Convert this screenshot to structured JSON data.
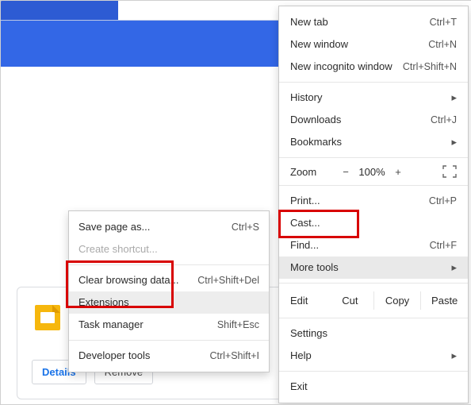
{
  "main_menu": {
    "new_tab": {
      "label": "New tab",
      "shortcut": "Ctrl+T"
    },
    "new_window": {
      "label": "New window",
      "shortcut": "Ctrl+N"
    },
    "new_incognito": {
      "label": "New incognito window",
      "shortcut": "Ctrl+Shift+N"
    },
    "history": {
      "label": "History"
    },
    "downloads": {
      "label": "Downloads",
      "shortcut": "Ctrl+J"
    },
    "bookmarks": {
      "label": "Bookmarks"
    },
    "zoom": {
      "label": "Zoom",
      "minus": "−",
      "pct": "100%",
      "plus": "+"
    },
    "print": {
      "label": "Print...",
      "shortcut": "Ctrl+P"
    },
    "cast": {
      "label": "Cast..."
    },
    "find": {
      "label": "Find...",
      "shortcut": "Ctrl+F"
    },
    "more_tools": {
      "label": "More tools"
    },
    "edit": {
      "label": "Edit",
      "cut": "Cut",
      "copy": "Copy",
      "paste": "Paste"
    },
    "settings": {
      "label": "Settings"
    },
    "help": {
      "label": "Help"
    },
    "exit": {
      "label": "Exit"
    }
  },
  "submenu": {
    "save_page": {
      "label": "Save page as...",
      "shortcut": "Ctrl+S"
    },
    "create_shortcut": {
      "label": "Create shortcut..."
    },
    "clear_data": {
      "label": "Clear browsing data...",
      "shortcut": "Ctrl+Shift+Del"
    },
    "extensions": {
      "label": "Extensions"
    },
    "task_manager": {
      "label": "Task manager",
      "shortcut": "Shift+Esc"
    },
    "dev_tools": {
      "label": "Developer tools",
      "shortcut": "Ctrl+Shift+I"
    }
  },
  "card": {
    "details": "Details",
    "remove": "Remove"
  }
}
